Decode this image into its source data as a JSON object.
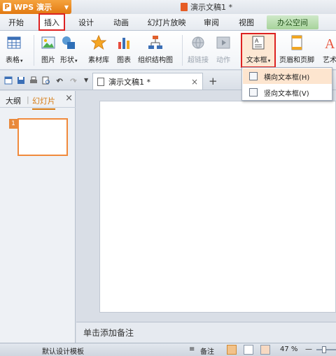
{
  "titlebar": {
    "app_name": "WPS 演示",
    "logo_letter": "P",
    "doc_title": "演示文稿1 *"
  },
  "menu": {
    "tabs": [
      {
        "label": "开始"
      },
      {
        "label": "插入"
      },
      {
        "label": "设计"
      },
      {
        "label": "动画"
      },
      {
        "label": "幻灯片放映"
      },
      {
        "label": "审阅"
      },
      {
        "label": "视图"
      },
      {
        "label": "办公空间"
      }
    ],
    "active": "插入"
  },
  "ribbon": {
    "buttons": [
      {
        "label": "表格"
      },
      {
        "label": "图片"
      },
      {
        "label": "形状"
      },
      {
        "label": "素材库"
      },
      {
        "label": "图表"
      },
      {
        "label": "组织结构图"
      },
      {
        "label": "超链接"
      },
      {
        "label": "动作"
      },
      {
        "label": "文本框"
      },
      {
        "label": "页眉和页脚"
      },
      {
        "label": "艺术"
      }
    ]
  },
  "quick_access": {
    "doc_tab_title": "演示文稿1 *",
    "close_label": "×",
    "new_tab_label": "+"
  },
  "left_panel": {
    "tab_outline": "大纲",
    "tab_slides": "幻灯片",
    "close_label": "×",
    "slide_number": "1"
  },
  "notes": {
    "placeholder": "单击添加备注"
  },
  "statusbar": {
    "template": "默认设计模板",
    "notes_label": "备注",
    "zoom": "47 %",
    "zoom_minus": "—"
  },
  "dropdown": {
    "items": [
      {
        "label": "横向文本框(H)"
      },
      {
        "label": "竖向文本框(V)"
      }
    ]
  },
  "colors": {
    "wps_orange": "#e27a12",
    "highlight_red": "#dd2222",
    "office_green": "#a7d39b",
    "active_slide_border": "#f08a3c"
  }
}
